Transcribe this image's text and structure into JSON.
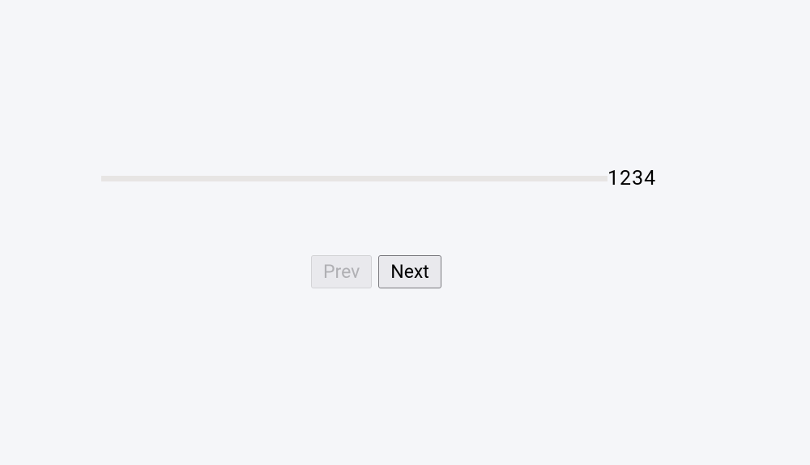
{
  "steps": {
    "numbers": "1234"
  },
  "buttons": {
    "prev_label": "Prev",
    "next_label": "Next"
  }
}
